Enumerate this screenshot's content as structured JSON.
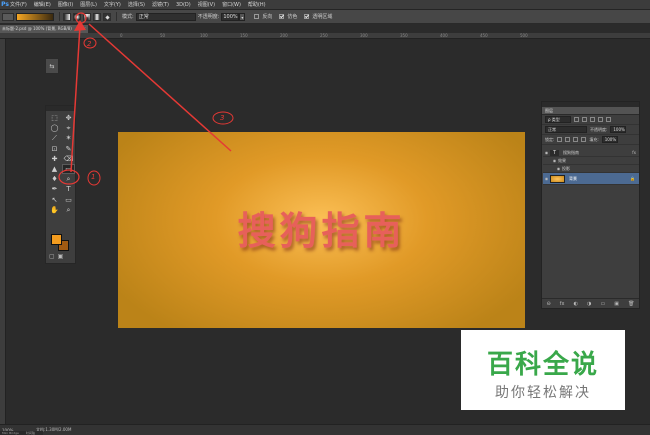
{
  "app": {
    "logo": "Ps"
  },
  "menubar": {
    "items": [
      "文件(F)",
      "编辑(E)",
      "图像(I)",
      "图层(L)",
      "文字(Y)",
      "选择(S)",
      "滤镜(T)",
      "3D(D)",
      "视图(V)",
      "窗口(W)",
      "帮助(H)"
    ]
  },
  "options": {
    "mode_label": "模式:",
    "mode_value": "正常",
    "opacity_label": "不透明度:",
    "opacity_value": "100%",
    "reverse_label": "反向",
    "dither_label": "仿色",
    "transparency_label": "透明区域",
    "gradient_colors": [
      "#f5a623",
      "#3a2a10"
    ]
  },
  "document": {
    "tab_title": "未标题-2.psd @ 100% (背景, RGB/8)",
    "close": "×"
  },
  "ruler": {
    "labels": [
      "0",
      "50",
      "100",
      "150",
      "200",
      "250",
      "300",
      "350",
      "400",
      "450",
      "500"
    ]
  },
  "toolbox": {
    "tools": [
      "⬚",
      "✥",
      "◯",
      "⌖",
      "⟋",
      "✶",
      "⊡",
      "✎",
      "✚",
      "⌫",
      "▲",
      "▭",
      "♦",
      "⌕",
      "✒",
      "T",
      "↖",
      "▭",
      "✋",
      "⌕"
    ],
    "fg_color": "#f39c1f",
    "bg_color": "#a05a12",
    "mode_buttons": [
      "▢",
      "▣"
    ]
  },
  "canvas": {
    "text": "搜狗指南",
    "gradient_center": "#fbbf55",
    "gradient_edge": "#bb8318",
    "text_color": "#e7605a"
  },
  "annotations": {
    "label1": "1",
    "label2": "2",
    "label3": "3",
    "color": "#e53935"
  },
  "layers_panel": {
    "tab": "图层",
    "filter_label": "ρ 类型",
    "blend_mode": "正常",
    "opacity_label": "不透明度:",
    "opacity_value": "100%",
    "lock_label": "锁定:",
    "fill_label": "填充:",
    "fill_value": "100%",
    "layers": [
      {
        "name": "搜狗指南",
        "thumb": "T",
        "fx": "fx"
      },
      {
        "name": "效果"
      },
      {
        "name": "投影"
      },
      {
        "name": "背景",
        "lock": "🔒"
      }
    ],
    "footer_icons": [
      "⊖",
      "fx",
      "◐",
      "◑",
      "▭",
      "▣",
      "🗑"
    ]
  },
  "watermark": {
    "title": "百科全说",
    "subtitle": "助你轻松解决"
  },
  "status": {
    "zoom": "100%",
    "doc": "文档:1.30M/2.00M"
  },
  "mini_bridge": [
    "Mini Bridge",
    "时间轴"
  ]
}
